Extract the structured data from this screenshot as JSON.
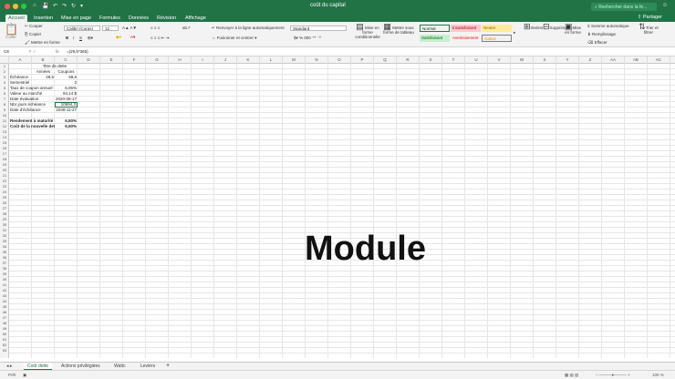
{
  "window": {
    "title": "coût du capital",
    "search_placeholder": "Rechercher dans la fe..."
  },
  "quick_access": [
    "⌂",
    "💾",
    "↶",
    "↷",
    "↻",
    "▾"
  ],
  "tabs": [
    "Accueil",
    "Insertion",
    "Mise en page",
    "Formules",
    "Données",
    "Révision",
    "Affichage"
  ],
  "share_label": "Partager",
  "ribbon": {
    "paste": "Coller",
    "cut": "Couper",
    "copy": "Copier",
    "format_painter": "Mettre en forme",
    "font_name": "Calibri (Corps)",
    "font_size": "12",
    "wrap_text": "Renvoyer à la ligne automatiquement",
    "merge": "Fusionner et centrer",
    "number_format": "Standard",
    "conditional_format": "Mise en forme conditionnelle",
    "table_format": "Mettre sous forme de tableau",
    "styles": [
      {
        "label": "Normal",
        "bg": "#ffffff",
        "fg": "#000000"
      },
      {
        "label": "Insatisfaisant",
        "bg": "#ffc7ce",
        "fg": "#9c0006"
      },
      {
        "label": "Neutre",
        "bg": "#ffeb9c",
        "fg": "#9c5700"
      },
      {
        "label": "Satisfaisant",
        "bg": "#c6efce",
        "fg": "#006100"
      },
      {
        "label": "Avertissement",
        "bg": "#ffffff",
        "fg": "#ff0000"
      },
      {
        "label": "Calcul",
        "bg": "#f2f2f2",
        "fg": "#fa7d00"
      }
    ],
    "insert": "Insérer",
    "delete": "Supprimer",
    "format": "Mise en forme",
    "autosum": "Somme automatique",
    "fill": "Remplissage",
    "clear": "Effacer",
    "sort_filter": "Trier et filtrer"
  },
  "formula_bar": {
    "cell_ref": "C8",
    "fx": "fx",
    "formula": "=(29,5*365)"
  },
  "columns": [
    "A",
    "B",
    "C",
    "D",
    "E",
    "F",
    "G",
    "H",
    "I",
    "J",
    "K",
    "L",
    "M",
    "N",
    "O",
    "P",
    "Q",
    "R",
    "S",
    "T",
    "U",
    "V",
    "W",
    "X",
    "Y",
    "Z",
    "AA",
    "AB",
    "AC"
  ],
  "rows": [
    "1",
    "2",
    "3",
    "4",
    "5",
    "6",
    "7",
    "8",
    "9",
    "10",
    "11",
    "12",
    "13",
    "14",
    "15",
    "16",
    "17",
    "18",
    "19",
    "20",
    "21",
    "22",
    "23",
    "24",
    "25",
    "26",
    "27",
    "28",
    "29",
    "30",
    "31",
    "32",
    "33",
    "34",
    "35",
    "36",
    "37",
    "38",
    "39",
    "40",
    "41",
    "42",
    "43",
    "44",
    "45",
    "46",
    "47",
    "48",
    "49",
    "50",
    "51",
    "52",
    "53"
  ],
  "cells": {
    "b1": "Titre de dette",
    "b2": "Années",
    "c2": "Coupons",
    "a3": "Échéance",
    "b3": "29,5",
    "c3": "58,6",
    "a4": "Semestriel",
    "c4": "2",
    "a5": "Taux de coupon annuel",
    "c5": "6,05%",
    "a6": "Valeur au marché",
    "c6": "94,14 $",
    "a7": "Date évaluation",
    "c7": "2020-08-17",
    "a8": "Nbr jours échéance",
    "c8": "10694,3",
    "a9": "Date d'échéance",
    "c9": "2049-11-27",
    "a11": "Rendement à maturité",
    "c11": "6,50%",
    "a12": "Coût de la nouvelle dette",
    "c12": "6,50%"
  },
  "overlay_text": "Module",
  "sheets": [
    "Coût dette",
    "Actions privilégiées",
    "Wattc",
    "Leviers"
  ],
  "status": {
    "ready": "Prêt",
    "zoom": "100 %"
  }
}
